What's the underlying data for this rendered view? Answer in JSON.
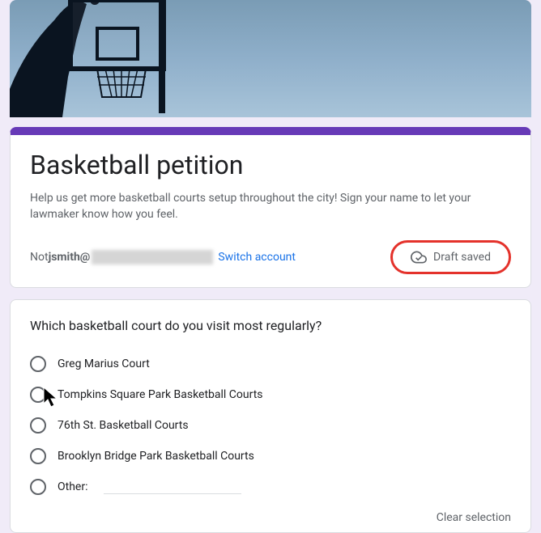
{
  "form": {
    "title": "Basketball petition",
    "description": "Help us get more basketball courts setup throughout the city! Sign your name to let your lawmaker know how you feel.",
    "account": {
      "not_prefix": "Not ",
      "email_visible": "jsmith@",
      "switch_label": "Switch account"
    },
    "draft_label": "Draft saved"
  },
  "question": {
    "prompt": "Which basketball court do you visit most regularly?",
    "options": [
      {
        "label": "Greg Marius Court"
      },
      {
        "label": "Tompkins Square Park Basketball Courts"
      },
      {
        "label": "76th St. Basketball Courts"
      },
      {
        "label": "Brooklyn Bridge Park Basketball Courts"
      }
    ],
    "other_label": "Other:",
    "clear_label": "Clear selection"
  }
}
